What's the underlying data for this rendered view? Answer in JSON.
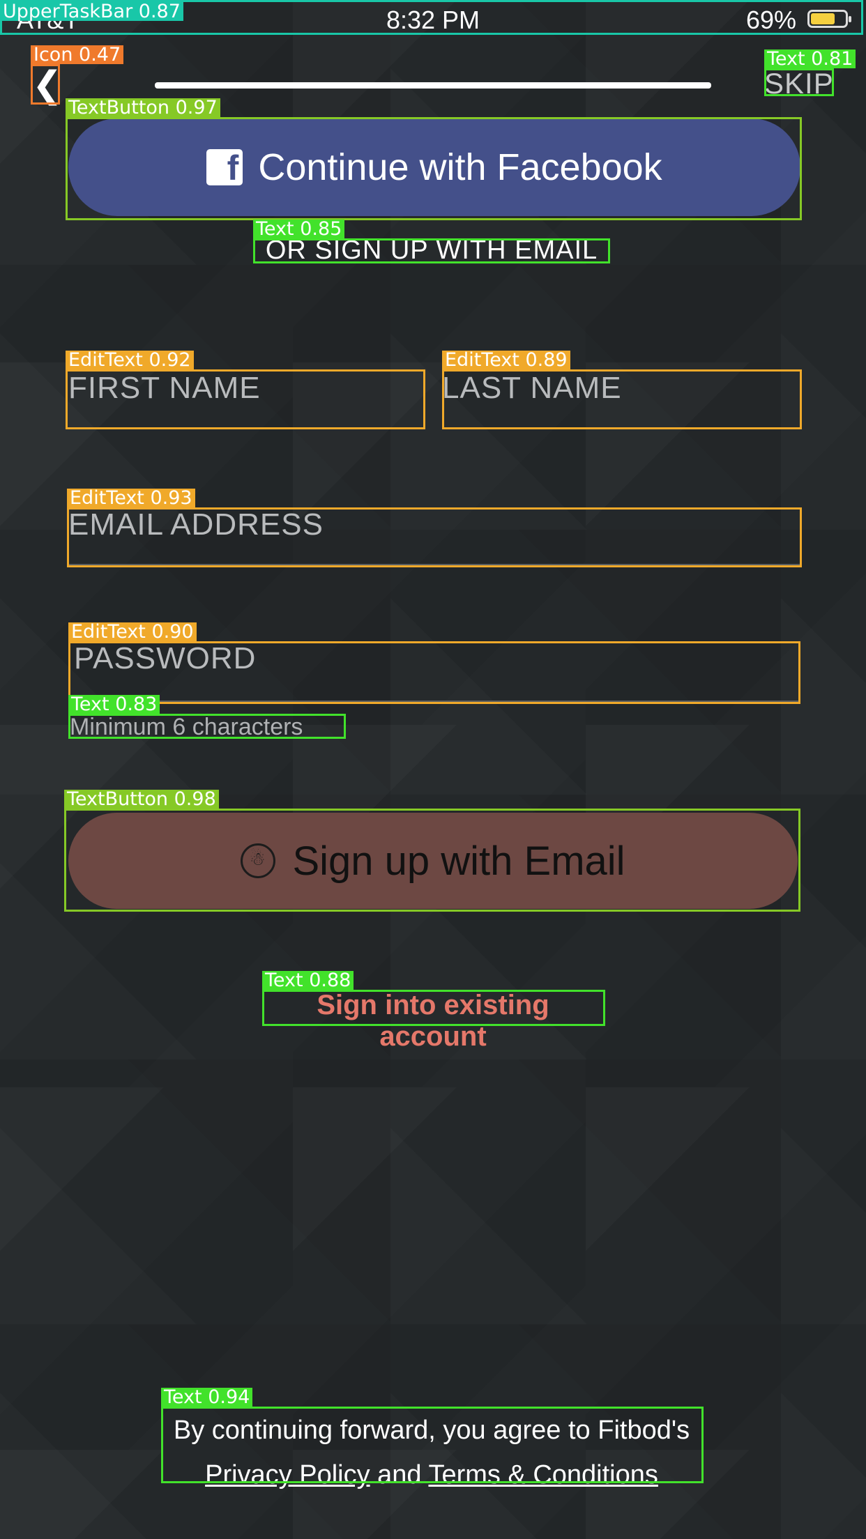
{
  "status_bar": {
    "carrier": "AT&T",
    "time": "8:32 PM",
    "battery": "69%"
  },
  "nav": {
    "skip_label": "SKIP"
  },
  "facebook_button": {
    "label": "Continue with Facebook",
    "glyph": "f"
  },
  "separator_text": "OR SIGN UP WITH EMAIL",
  "form": {
    "first_name_placeholder": "FIRST NAME",
    "last_name_placeholder": "LAST NAME",
    "email_placeholder": "EMAIL ADDRESS",
    "password_placeholder": "PASSWORD",
    "password_hint": "Minimum 6 characters"
  },
  "email_button": {
    "label": "Sign up with Email"
  },
  "signin_link": "Sign into existing account",
  "legal": {
    "line1": "By continuing forward, you agree to Fitbod's",
    "privacy": "Privacy Policy",
    "and": "and",
    "terms": "Terms & Conditions"
  },
  "annotations": {
    "status_bar": "UpperTaskBar 0.87",
    "back_icon": "Icon 0.47",
    "skip": "Text 0.81",
    "facebook_button": "TextButton 0.97",
    "separator": "Text 0.85",
    "first_name_field": "EditText 0.92",
    "last_name_field": "EditText 0.89",
    "email_field": "EditText 0.93",
    "password_field": "EditText 0.90",
    "password_hint": "Text 0.83",
    "email_button": "TextButton 0.98",
    "signin_link": "Text 0.88",
    "legal_text": "Text 0.94"
  },
  "colors": {
    "background": "#24282a",
    "facebook": "#44508a",
    "email_button": "#6d4843",
    "signin_link": "#e5786a"
  }
}
